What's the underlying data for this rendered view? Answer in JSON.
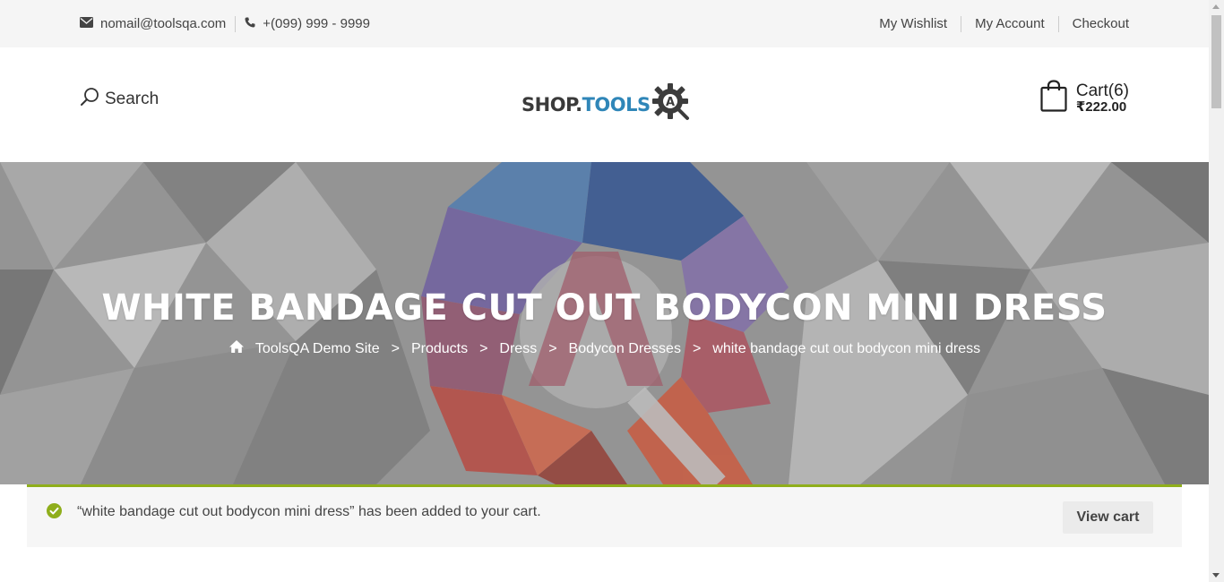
{
  "topbar": {
    "email": "nomail@toolsqa.com",
    "phone": "+(099) 999 - 9999",
    "links": [
      "My Wishlist",
      "My Account",
      "Checkout"
    ]
  },
  "header": {
    "search_label": "Search",
    "logo_part1": "SHOP.",
    "logo_part2": "TOOLS",
    "logo_badge": "A",
    "cart_label": "Cart(6)",
    "cart_total": "₹222.00"
  },
  "hero": {
    "title": "WHITE BANDAGE CUT OUT BODYCON MINI DRESS",
    "breadcrumb": [
      "ToolsQA Demo Site",
      "Products",
      "Dress",
      "Bodycon Dresses",
      "white bandage cut out bodycon mini dress"
    ],
    "separator": ">"
  },
  "notice": {
    "message": "“white bandage cut out bodycon mini dress” has been added to your cart.",
    "button": "View cart"
  },
  "icons": {
    "email": "envelope-icon",
    "phone": "phone-icon",
    "search": "search-icon",
    "cart": "shopping-bag-icon",
    "home": "home-icon",
    "success": "check-circle-icon"
  },
  "colors": {
    "accent_green": "#8fae1b",
    "logo_blue": "#2f86b8"
  }
}
